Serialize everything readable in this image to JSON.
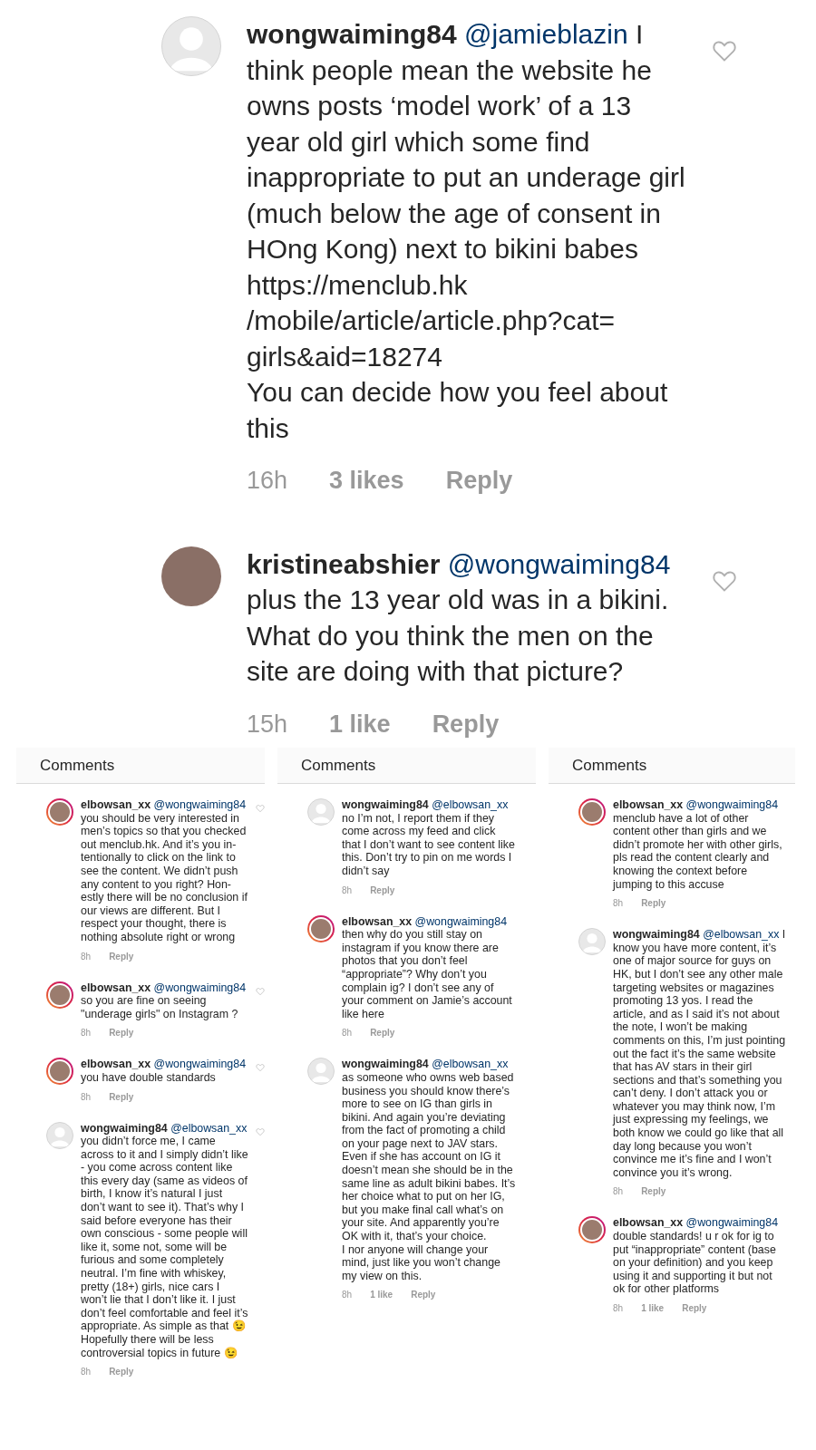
{
  "thread": {
    "comments": [
      {
        "kind": "placeholder",
        "username": "wongwaiming84",
        "mention": "@jamieblazin",
        "text": "I think people mean the website he owns posts ‘model work’ of a 13 year old girl which some find inappropriate to put an underage girl (much below the age of consent in HOng Kong) next to bikini babes https://menclub.hk /mobile/article/article.php?cat= girls&aid=18274\nYou can decide how you feel about this",
        "time": "16h",
        "likes": "3 likes",
        "reply": "Reply"
      },
      {
        "kind": "photo",
        "username": "kristineabshier",
        "mention": "@wongwaiming84",
        "text": "plus the 13 year old was in a bikini. What do you think the men on the site are doing with that picture?",
        "time": "15h",
        "likes": "1 like",
        "reply": "Reply"
      }
    ]
  },
  "panels": [
    {
      "title": "Comments",
      "heart_icons": true,
      "comments": [
        {
          "kind": "photo",
          "username": "elbowsan_xx",
          "mention": "@wongwaiming84",
          "text": "you should be very interested in men’s topics so that you checked out menclub.hk. And it’s you in- tentionally to click on the link to see the content. We didn’t push any content to you right? Hon- estly there will be no conclusion if our views are different. But I respect your thought, there is nothing absolute right or wrong",
          "time": "8h",
          "reply": "Reply"
        },
        {
          "kind": "photo",
          "username": "elbowsan_xx",
          "mention": "@wongwaiming84",
          "text": "so you are fine on seeing \"underage girls\" on Instagram ?",
          "time": "8h",
          "reply": "Reply"
        },
        {
          "kind": "photo",
          "username": "elbowsan_xx",
          "mention": "@wongwaiming84",
          "text": "you have double standards",
          "time": "8h",
          "reply": "Reply"
        },
        {
          "kind": "placeholder",
          "username": "wongwaiming84",
          "mention": "@elbowsan_xx",
          "text": "you didn’t force me, I came across to it and I simply didn’t like - you come across content like this every day (same as videos of birth, I know it’s natural I just don’t want to see it). That’s why I said before everyone has their own conscious - some people will like it, some not, some will be furious and some completely neutral. I’m fine with whiskey, pretty (18+) girls, nice cars I won’t lie that I don’t like it. I just don’t feel comfortable and feel it’s appropriate. As simple as that 😉 Hopefully there will be less controversial topics in future 😉",
          "time": "8h",
          "reply": "Reply"
        }
      ]
    },
    {
      "title": "Comments",
      "heart_icons": false,
      "comments": [
        {
          "kind": "placeholder",
          "username": "wongwaiming84",
          "mention": "@elbowsan_xx",
          "text": "no I’m not, I report them if they come across my feed and click that I don’t want to see content like this. Don’t try to pin on me words I didn’t say",
          "time": "8h",
          "reply": "Reply"
        },
        {
          "kind": "photo",
          "username": "elbowsan_xx",
          "mention": "@wongwaiming84",
          "text": "then why do you still stay on instagram if you know there are photos that you don’t feel “appropriate”? Why don’t you complain ig? I don’t see any of your comment on Jamie’s account like here",
          "time": "8h",
          "reply": "Reply"
        },
        {
          "kind": "placeholder",
          "username": "wongwaiming84",
          "mention": "@elbowsan_xx",
          "text": "as someone who owns web based business you should know there’s more to see on IG than girls in bikini. And again you’re deviating from the fact of promoting a child on your page next to JAV stars. Even if she has account on IG it doesn’t mean she should be in the same line as adult bikini babes. It’s her choice what to put on her IG, but you make final call what’s on your site. And apparently you’re OK with it, that’s your choice.\nI nor anyone will change your mind, just like you won’t change my view on this.",
          "time": "8h",
          "likes": "1 like",
          "reply": "Reply"
        }
      ]
    },
    {
      "title": "Comments",
      "heart_icons": false,
      "comments": [
        {
          "kind": "photo",
          "username": "elbowsan_xx",
          "mention": "@wongwaiming84",
          "text": "menclub have a lot of other content other than girls and we didn’t promote her with other girls, pls read the content clearly and knowing the context before jumping to this accuse",
          "time": "8h",
          "reply": "Reply"
        },
        {
          "kind": "placeholder",
          "username": "wongwaiming84",
          "mention": "@elbowsan_xx",
          "text": "I know you have more content, it’s one of major source for guys on HK, but I don’t see any other male targeting websites or magazines promoting 13 yos. I read the article, and as I said it’s not about the note, I won’t be making comments on this, I’m just pointing out the fact it’s the same website that has AV stars in their girl sections and that’s something you can’t deny. I don’t attack you or whatever you may think now, I’m just expressing my feelings, we both know we could go like that all day long because you won’t convince me it’s fine and I won’t convince you it’s wrong.",
          "time": "8h",
          "reply": "Reply"
        },
        {
          "kind": "photo",
          "username": "elbowsan_xx",
          "mention": "@wongwaiming84",
          "text": "double standards! u r ok for ig to put “inappropriate” content (base on your definition) and you keep using it and supporting it but not ok for other platforms",
          "time": "8h",
          "likes": "1 like",
          "reply": "Reply"
        }
      ]
    }
  ]
}
